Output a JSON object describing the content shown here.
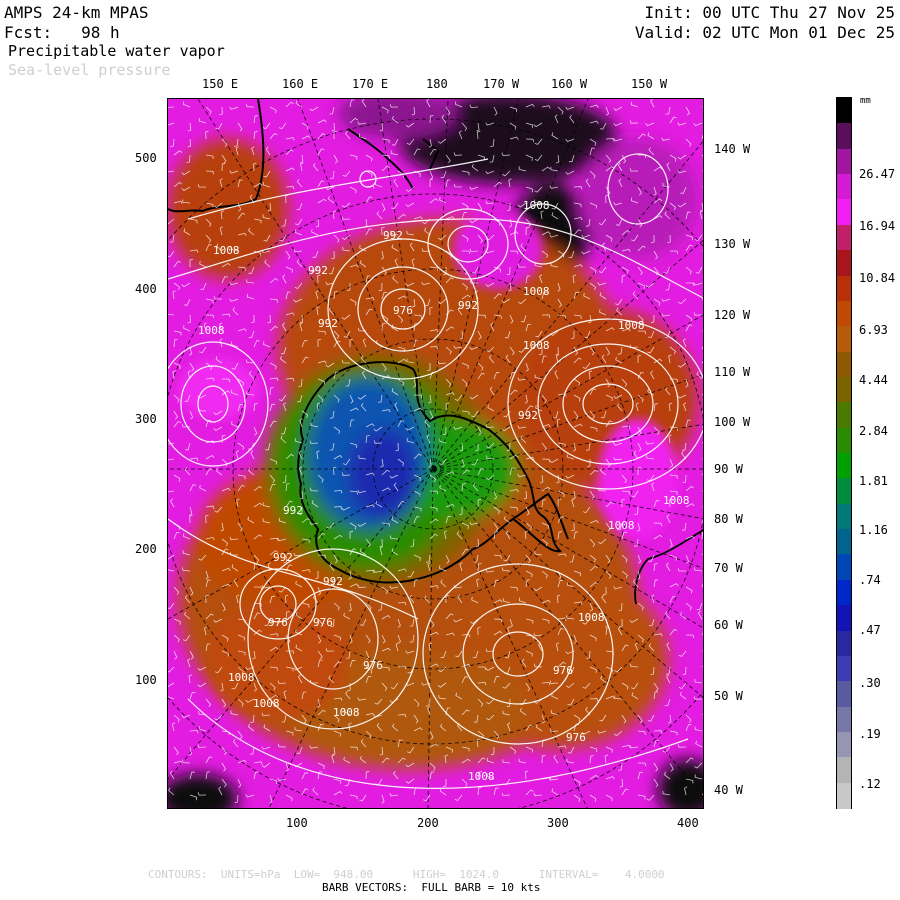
{
  "header": {
    "model": "AMPS 24-km MPAS",
    "forecast": "Fcst:   98 h",
    "field_primary": "Precipitable water vapor",
    "field_secondary": "Sea-level pressure",
    "init": "Init: 00 UTC Thu 27 Nov 25",
    "valid": "Valid: 02 UTC Mon 01 Dec 25"
  },
  "map": {
    "top_lon_labels": [
      "150 E",
      "160 E",
      "170 E",
      "180",
      "170 W",
      "160 W",
      "150 W"
    ],
    "right_lon_labels": [
      "140 W",
      "130 W",
      "120 W",
      "110 W",
      "100 W",
      "90 W",
      "80 W",
      "70 W",
      "60 W",
      "50 W",
      "40 W"
    ],
    "left_y_ticks": [
      "500",
      "400",
      "300",
      "200",
      "100"
    ],
    "bottom_x_ticks": [
      "100",
      "200",
      "300",
      "400"
    ],
    "isobar_labels": [
      "1008",
      "1008",
      "1008",
      "1008",
      "1008",
      "1008",
      "1008",
      "1008",
      "1008",
      "1008",
      "1008",
      "1008",
      "1008",
      "992",
      "992",
      "992",
      "992",
      "992",
      "992",
      "992",
      "992",
      "976",
      "976",
      "976",
      "976",
      "976",
      "976"
    ]
  },
  "colorbar": {
    "unit": "mm",
    "labels": [
      "26.47",
      "16.94",
      "10.84",
      "6.93",
      "4.44",
      "2.84",
      "1.81",
      "1.16",
      ".74",
      ".47",
      ".30",
      ".19",
      ".12"
    ],
    "colors_top_to_bottom": [
      "#000000",
      "#5a0f5a",
      "#a0169f",
      "#d21bd2",
      "#f01ef0",
      "#c0206a",
      "#a8151d",
      "#b8300a",
      "#bf4a05",
      "#b45a0a",
      "#8c5a00",
      "#7a6400",
      "#4a7a00",
      "#2a8c00",
      "#00a000",
      "#008c3c",
      "#007878",
      "#00648c",
      "#0046b4",
      "#0028c8",
      "#1414b4",
      "#2828a0",
      "#3c3cb4",
      "#5a5aa0",
      "#7878a8",
      "#9696b4",
      "#b4b4b4",
      "#c8c8c8"
    ]
  },
  "footer": {
    "contours": "CONTOURS:  UNITS=hPa  LOW=  948.00      HIGH=  1024.0      INTERVAL=    4.0000",
    "barbs": "BARB VECTORS:  FULL BARB = 10 kts"
  }
}
